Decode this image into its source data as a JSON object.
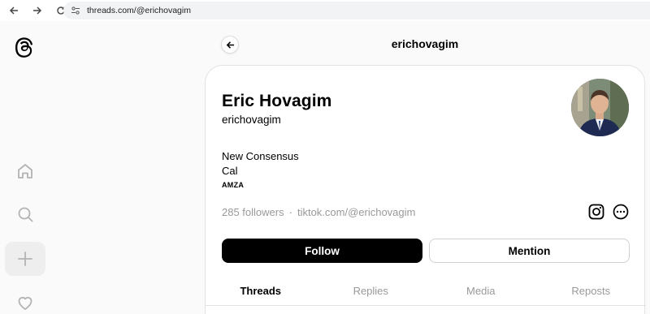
{
  "browser": {
    "url": "threads.com/@erichovagim"
  },
  "header": {
    "title": "erichovagim"
  },
  "profile": {
    "name": "Eric Hovagim",
    "handle": "erichovagim",
    "bio": [
      "New Consensus",
      "Cal"
    ],
    "bio_small": "AMZA",
    "followers": "285 followers",
    "separator": "·",
    "link": "tiktok.com/@erichovagim"
  },
  "actions": {
    "follow_label": "Follow",
    "mention_label": "Mention"
  },
  "tabs": [
    {
      "label": "Threads",
      "active": true
    },
    {
      "label": "Replies",
      "active": false
    },
    {
      "label": "Media",
      "active": false
    },
    {
      "label": "Reposts",
      "active": false
    }
  ],
  "sidebar": {
    "items": [
      {
        "icon": "home-icon"
      },
      {
        "icon": "search-icon"
      },
      {
        "icon": "create-icon"
      },
      {
        "icon": "heart-icon"
      }
    ]
  }
}
